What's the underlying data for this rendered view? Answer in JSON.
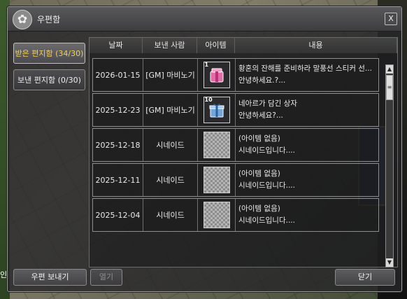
{
  "window": {
    "title": "우편함",
    "close_symbol": "X"
  },
  "tabs": [
    {
      "label": "받은 편지함 (34/30)",
      "active": true
    },
    {
      "label": "보낸 편지함 (0/30)",
      "active": false
    }
  ],
  "columns": {
    "date": "날짜",
    "sender": "보낸 사람",
    "item": "아이템",
    "content": "내용"
  },
  "rows": [
    {
      "date": "2026-01-15",
      "sender": "[GM] 마비노기",
      "item": {
        "quantity": "1",
        "icon": "pink-box-icon"
      },
      "content_line1": "황혼의 잔해를 준비하라 말풍선 스티커 선...",
      "content_line2": "안녕하세요.?..."
    },
    {
      "date": "2025-12-23",
      "sender": "[GM] 마비노기",
      "item": {
        "quantity": "10",
        "icon": "blue-gift-box-icon"
      },
      "content_line1": "네아르가 담긴 상자",
      "content_line2": "안녕하세요?..."
    },
    {
      "date": "2025-12-18",
      "sender": "시네이드",
      "item": null,
      "content_line1": "(아이템 없음)",
      "content_line2": "시네이드입니다...."
    },
    {
      "date": "2025-12-11",
      "sender": "시네이드",
      "item": null,
      "content_line1": "(아이템 없음)",
      "content_line2": "시네이드입니다...."
    },
    {
      "date": "2025-12-04",
      "sender": "시네이드",
      "item": null,
      "content_line1": "(아이템 없음)",
      "content_line2": "시네이드입니다...."
    }
  ],
  "scrollbar": {
    "up": "▲",
    "down": "▼",
    "thumb": "≡"
  },
  "buttons": {
    "send": "우편 보내기",
    "open": "열기",
    "close": "닫기"
  },
  "background_text": "인"
}
